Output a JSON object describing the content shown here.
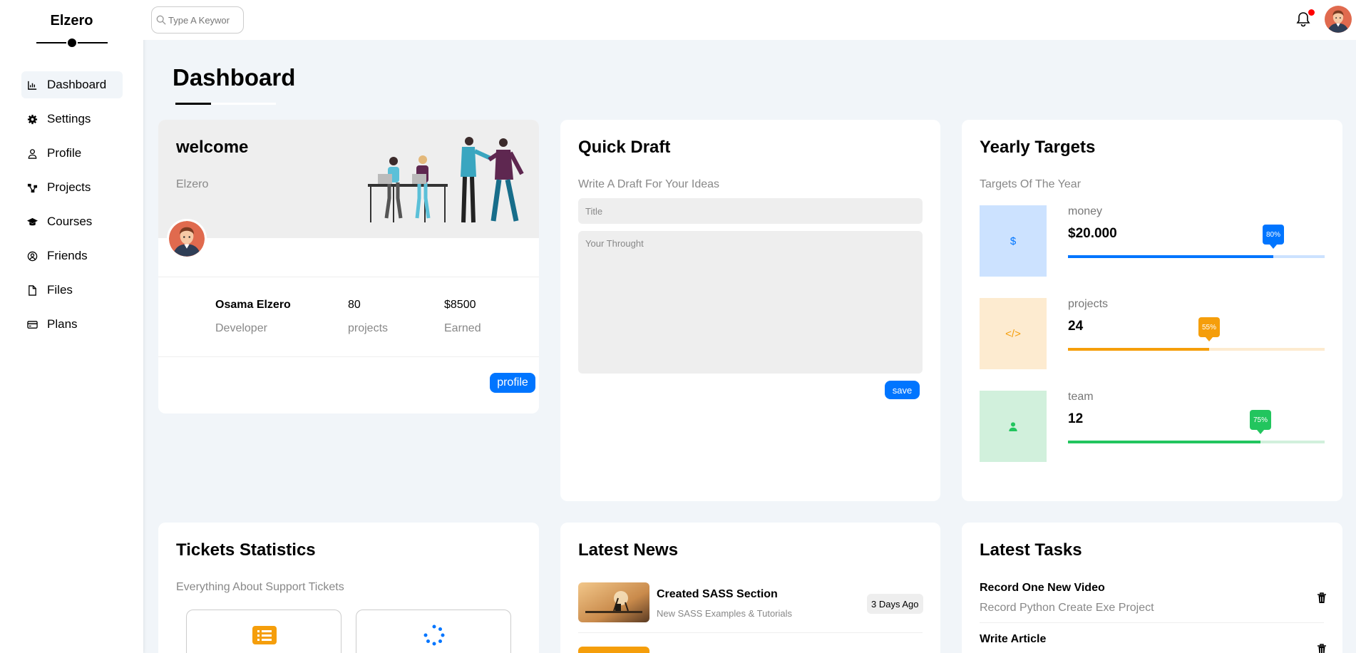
{
  "sidebar": {
    "logo": "Elzero",
    "items": [
      {
        "label": "Dashboard",
        "icon": "chart-icon"
      },
      {
        "label": "Settings",
        "icon": "gear-icon"
      },
      {
        "label": "Profile",
        "icon": "user-icon"
      },
      {
        "label": "Projects",
        "icon": "diagram-icon"
      },
      {
        "label": "Courses",
        "icon": "graduation-cap-icon"
      },
      {
        "label": "Friends",
        "icon": "user-circle-icon"
      },
      {
        "label": "Files",
        "icon": "file-icon"
      },
      {
        "label": "Plans",
        "icon": "credit-card-icon"
      }
    ]
  },
  "topbar": {
    "search_placeholder": "Type A Keywor"
  },
  "page": {
    "title": "Dashboard"
  },
  "welcome": {
    "title": "welcome",
    "subtitle": "Elzero",
    "name": "Osama Elzero",
    "role": "Developer",
    "projects_value": "80",
    "projects_label": "projects",
    "earned_value": "$8500",
    "earned_label": "Earned",
    "button": "profile"
  },
  "draft": {
    "title": "Quick Draft",
    "subtitle": "Write A Draft For Your Ideas",
    "title_placeholder": "Title",
    "body_placeholder": "Your Throught",
    "button": "save"
  },
  "targets": {
    "title": "Yearly Targets",
    "subtitle": "Targets Of The Year",
    "items": [
      {
        "name": "money",
        "value": "$20.000",
        "percent": 80,
        "percent_label": "80%",
        "icon": "$",
        "color": "#0075ff",
        "bg": "#cce2ff"
      },
      {
        "name": "projects",
        "value": "24",
        "percent": 55,
        "percent_label": "55%",
        "icon": "</>",
        "color": "#f59e0b",
        "bg": "#fdebd0"
      },
      {
        "name": "team",
        "value": "12",
        "percent": 75,
        "percent_label": "75%",
        "icon": "user",
        "color": "#22c55e",
        "bg": "#d1f0dc"
      }
    ]
  },
  "tickets": {
    "title": "Tickets Statistics",
    "subtitle": "Everything About Support Tickets"
  },
  "news": {
    "title": "Latest News",
    "item_title": "Created SASS Section",
    "item_desc": "New SASS Examples & Tutorials",
    "item_date": "3 Days Ago"
  },
  "tasks": {
    "title": "Latest Tasks",
    "items": [
      {
        "title": "Record One New Video",
        "desc": "Record Python Create Exe Project"
      },
      {
        "title": "Write Article",
        "desc": ""
      }
    ]
  }
}
